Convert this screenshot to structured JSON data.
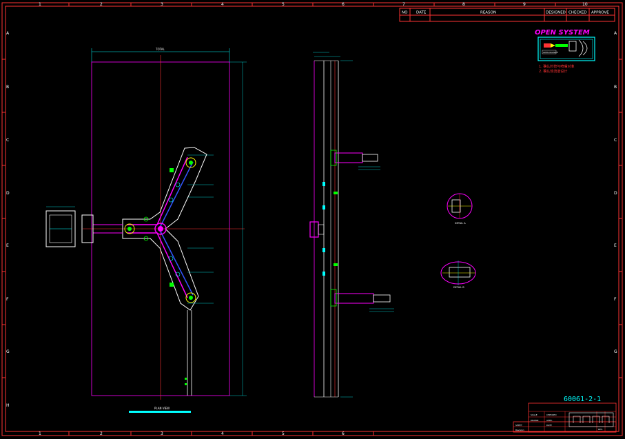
{
  "revision_table": {
    "headers": [
      "NO",
      "DATE",
      "REASON",
      "DESIGNED",
      "CHECKED",
      "APPROVE"
    ]
  },
  "column_markers_top": [
    "1",
    "2",
    "3",
    "4",
    "5",
    "6",
    "7",
    "8",
    "9",
    "10"
  ],
  "column_markers_bottom": [
    "1",
    "2",
    "3",
    "4",
    "5",
    "6"
  ],
  "row_markers": [
    "A",
    "B",
    "C",
    "D",
    "E",
    "F",
    "G",
    "H"
  ],
  "open_system": {
    "title": "OPEN SYSTEM",
    "icon_label": "OPEN NOZZLE",
    "notes": [
      "1. 确认料管与喷嘴对准",
      "2. 确认热流道设计"
    ]
  },
  "drawing_number": "60061-2-1",
  "views": {
    "front_view_caption": "PLAN VIEW",
    "top_dim_label": "TOTAL",
    "detail_a_label": "DETAIL A",
    "detail_b_label": "DETAIL B"
  },
  "title_block": {
    "cells": [
      "SCALE",
      "DRAWN",
      "CHECKED",
      "APPR.",
      "SHEET",
      "Revision",
      "DATE",
      "REV."
    ]
  },
  "colors": {
    "border": "#ff3333",
    "magenta": "#ff00ff",
    "cyan": "#00ffff",
    "yellow": "#ffff00",
    "green": "#00ff00",
    "white": "#ffffff",
    "blue": "#3355ff"
  }
}
